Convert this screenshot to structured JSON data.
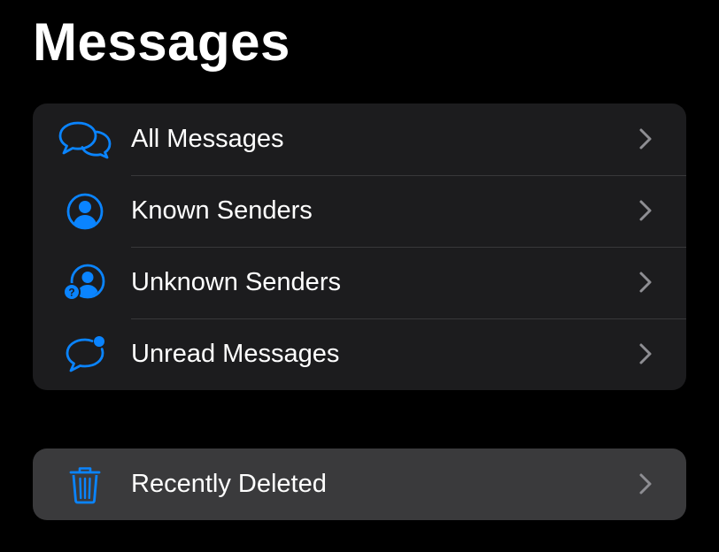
{
  "header": {
    "title": "Messages"
  },
  "filters": {
    "items": [
      {
        "label": "All Messages",
        "icon": "speech-bubbles-icon"
      },
      {
        "label": "Known Senders",
        "icon": "person-circle-icon"
      },
      {
        "label": "Unknown Senders",
        "icon": "unknown-person-icon"
      },
      {
        "label": "Unread Messages",
        "icon": "unread-bubble-icon"
      }
    ]
  },
  "deleted": {
    "label": "Recently Deleted",
    "icon": "trash-icon"
  },
  "colors": {
    "accent": "#0a84ff",
    "background": "#000000",
    "group_background": "#1c1c1e",
    "selected_background": "#3a3a3c",
    "chevron": "#8e8e93",
    "separator": "#38383a"
  }
}
